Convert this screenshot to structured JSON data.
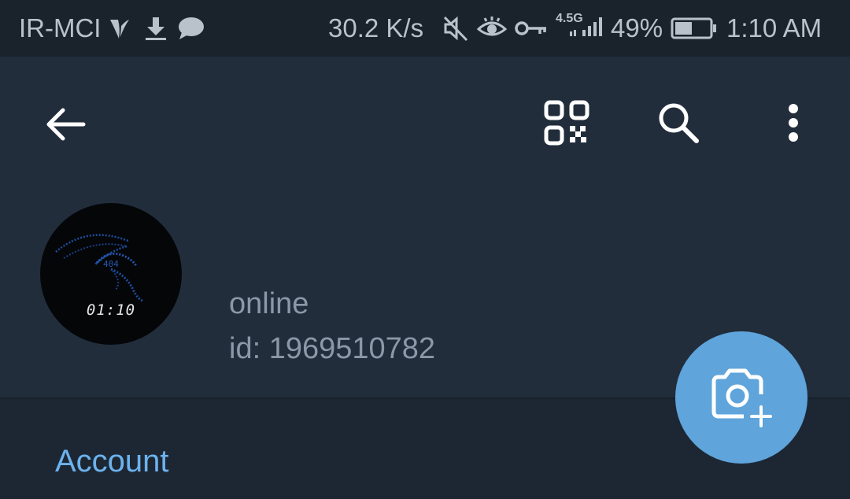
{
  "status_bar": {
    "carrier": "IR-MCI",
    "speed": "30.2 K/s",
    "network_type": "4.5G",
    "battery": "49%",
    "battery_level": 0.49,
    "time": "1:10 AM"
  },
  "avatar": {
    "time_text": "01:10",
    "logo_text": "404"
  },
  "profile": {
    "status": "online",
    "id_text": "id: 1969510782"
  },
  "sections": {
    "account_title": "Account"
  },
  "colors": {
    "accent": "#6cb2ee",
    "fab": "#5fa4db",
    "header_bg": "#212d3b",
    "body_bg": "#1d2733"
  },
  "icons": {
    "back": "arrow-left-icon",
    "qr": "qr-code-icon",
    "search": "search-icon",
    "menu": "more-vertical-icon",
    "camera": "camera-add-icon"
  }
}
